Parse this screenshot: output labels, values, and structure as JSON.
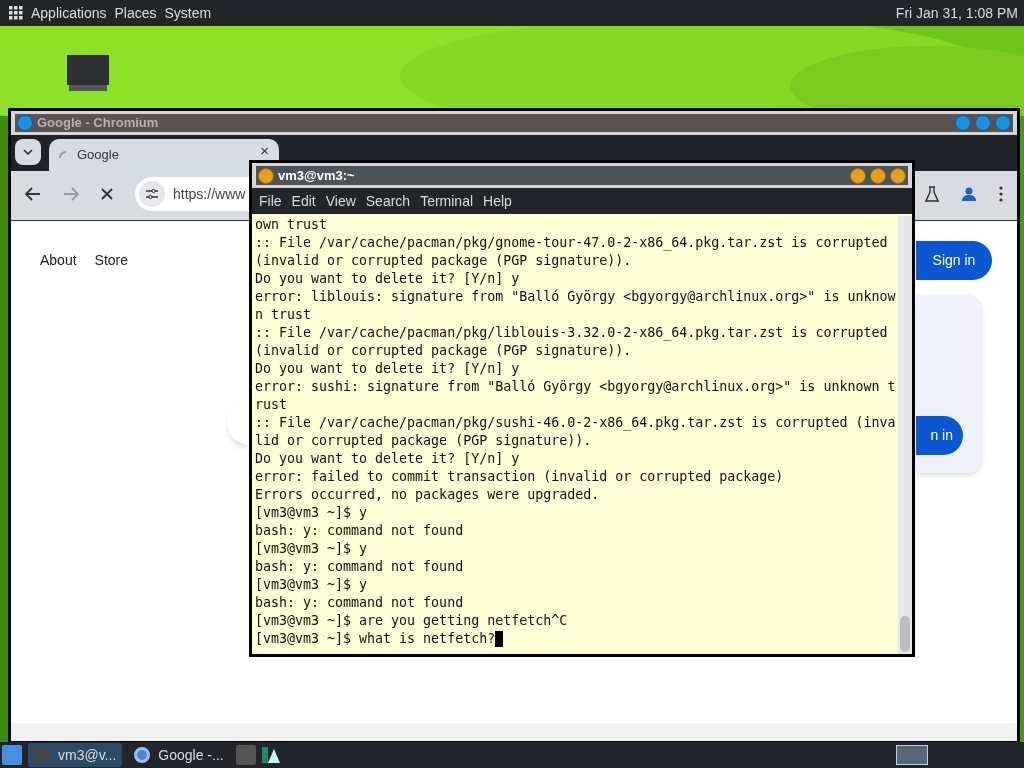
{
  "top_panel": {
    "menus": [
      "Applications",
      "Places",
      "System"
    ],
    "clock": "Fri Jan 31, 1:08 PM"
  },
  "browser": {
    "title": "Google - Chromium",
    "tab": {
      "label": "Google",
      "close": "×"
    },
    "url": "https://www",
    "nav_links": [
      "About",
      "Store"
    ],
    "sign_in": "Sign in",
    "card_button": "n in"
  },
  "terminal": {
    "title": "vm3@vm3:~",
    "menu": [
      "File",
      "Edit",
      "View",
      "Search",
      "Terminal",
      "Help"
    ],
    "lines": [
      "own trust",
      ":: File /var/cache/pacman/pkg/gnome-tour-47.0-2-x86_64.pkg.tar.zst is corrupted",
      "(invalid or corrupted package (PGP signature)).",
      "Do you want to delete it? [Y/n] y",
      "error: liblouis: signature from \"Balló György <bgyorgy@archlinux.org>\" is unknow",
      "n trust",
      ":: File /var/cache/pacman/pkg/liblouis-3.32.0-2-x86_64.pkg.tar.zst is corrupted",
      "(invalid or corrupted package (PGP signature)).",
      "Do you want to delete it? [Y/n] y",
      "error: sushi: signature from \"Balló György <bgyorgy@archlinux.org>\" is unknown t",
      "rust",
      ":: File /var/cache/pacman/pkg/sushi-46.0-2-x86_64.pkg.tar.zst is corrupted (inva",
      "lid or corrupted package (PGP signature)).",
      "Do you want to delete it? [Y/n] y",
      "error: failed to commit transaction (invalid or corrupted package)",
      "Errors occurred, no packages were upgraded.",
      "[vm3@vm3 ~]$ y",
      "bash: y: command not found",
      "[vm3@vm3 ~]$ y",
      "bash: y: command not found",
      "[vm3@vm3 ~]$ y",
      "bash: y: command not found",
      "[vm3@vm3 ~]$ are you getting netfetch^C",
      "[vm3@vm3 ~]$ what is netfetch?"
    ]
  },
  "taskbar": {
    "tasks": [
      {
        "label": "vm3@v...",
        "kind": "terminal",
        "selected": true
      },
      {
        "label": "Google -...",
        "kind": "browser",
        "selected": false
      }
    ]
  }
}
